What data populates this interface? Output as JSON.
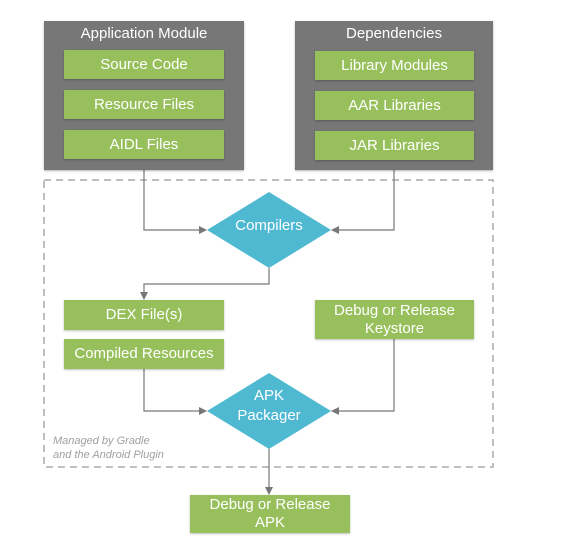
{
  "colors": {
    "panel": "#777777",
    "box": "#97c05c",
    "diamond": "#50b9d2",
    "arrow": "#777777",
    "dashed": "#aaaaaa"
  },
  "application_module": {
    "title": "Application Module",
    "items": [
      "Source Code",
      "Resource Files",
      "AIDL Files"
    ]
  },
  "dependencies": {
    "title": "Dependencies",
    "items": [
      "Library Modules",
      "AAR Libraries",
      "JAR Libraries"
    ]
  },
  "compilers": "Compilers",
  "outputs": {
    "dex": "DEX File(s)",
    "compiled_resources": "Compiled Resources",
    "keystore_line1": "Debug or Release",
    "keystore_line2": "Keystore"
  },
  "apk_packager": {
    "line1": "APK",
    "line2": "Packager"
  },
  "managed_note": {
    "line1": "Managed by Gradle",
    "line2": "and the Android Plugin"
  },
  "final_apk": {
    "line1": "Debug or Release",
    "line2": "APK"
  }
}
